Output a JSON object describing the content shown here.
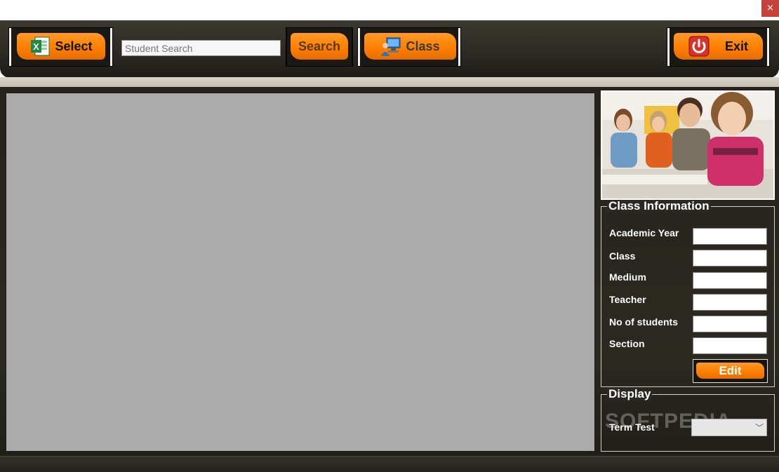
{
  "window": {
    "close_glyph": "×"
  },
  "toolbar": {
    "select_label": "Select",
    "search_placeholder": "Student Search",
    "search_label": "Search",
    "class_label": "Class",
    "exit_label": "Exit"
  },
  "icons": {
    "select": "excel-icon",
    "class": "computer-user-icon",
    "exit": "power-icon"
  },
  "class_information": {
    "title": "Class Information",
    "fields": [
      {
        "label": "Academic Year",
        "value": ""
      },
      {
        "label": "Class",
        "value": ""
      },
      {
        "label": "Medium",
        "value": ""
      },
      {
        "label": "Teacher",
        "value": ""
      },
      {
        "label": "No of students",
        "value": ""
      },
      {
        "label": "Section",
        "value": ""
      }
    ],
    "edit_label": "Edit"
  },
  "display": {
    "title": "Display",
    "term_test_label": "Term Test",
    "term_test_value": ""
  },
  "watermark": "SOFTPEDIA",
  "colors": {
    "accent_orange": "#ff8000",
    "toolbar_dark": "#2b2922",
    "grid_gray": "#ababab",
    "close_red": "#c8413b"
  }
}
